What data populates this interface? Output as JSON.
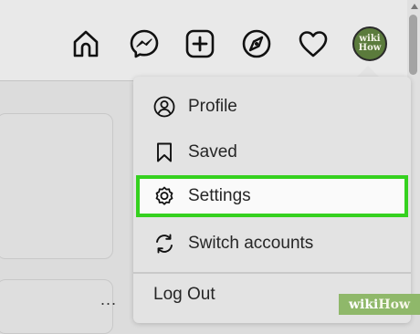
{
  "nav": {
    "icons": [
      "home-icon",
      "messenger-icon",
      "new-post-icon",
      "explore-icon",
      "heart-icon",
      "avatar"
    ],
    "avatar_line1": "wiki",
    "avatar_line2": "How"
  },
  "menu": {
    "items": [
      {
        "icon": "profile-icon",
        "label": "Profile"
      },
      {
        "icon": "bookmark-icon",
        "label": "Saved"
      },
      {
        "icon": "settings-gear-icon",
        "label": "Settings",
        "highlighted": true
      },
      {
        "icon": "switch-accounts-icon",
        "label": "Switch accounts"
      }
    ],
    "logout_label": "Log Out"
  },
  "feed": {
    "more_label": "..."
  },
  "watermark": {
    "part1": "wiki",
    "part2": "How"
  },
  "colors": {
    "highlight_border": "#35d11f",
    "menu_bg": "#e3e3e3",
    "page_bg": "#dcdcdc"
  }
}
